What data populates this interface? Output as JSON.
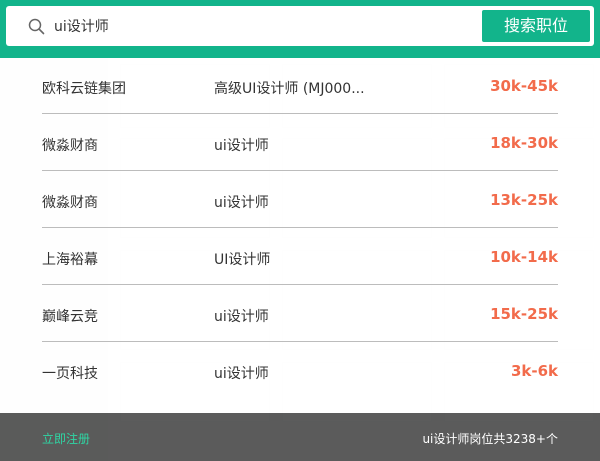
{
  "search": {
    "query": "ui设计师",
    "button_label": "搜索职位"
  },
  "results": [
    {
      "company": "欧科云链集团",
      "position": "高级UI设计师 (MJ000...",
      "salary": "30k-45k"
    },
    {
      "company": "微淼财商",
      "position": "ui设计师",
      "salary": "18k-30k"
    },
    {
      "company": "微淼财商",
      "position": "ui设计师",
      "salary": "13k-25k"
    },
    {
      "company": "上海裕幕",
      "position": "UI设计师",
      "salary": "10k-14k"
    },
    {
      "company": "巅峰云竞",
      "position": "ui设计师",
      "salary": "15k-25k"
    },
    {
      "company": "一页科技",
      "position": "ui设计师",
      "salary": "3k-6k"
    }
  ],
  "footer": {
    "register_label": "立即注册",
    "total_text": "ui设计师岗位共3238+个"
  },
  "colors": {
    "brand": "#12b48b",
    "salary": "#f26b4b",
    "register": "#2fd6a4",
    "footer_bg": "#464646"
  }
}
